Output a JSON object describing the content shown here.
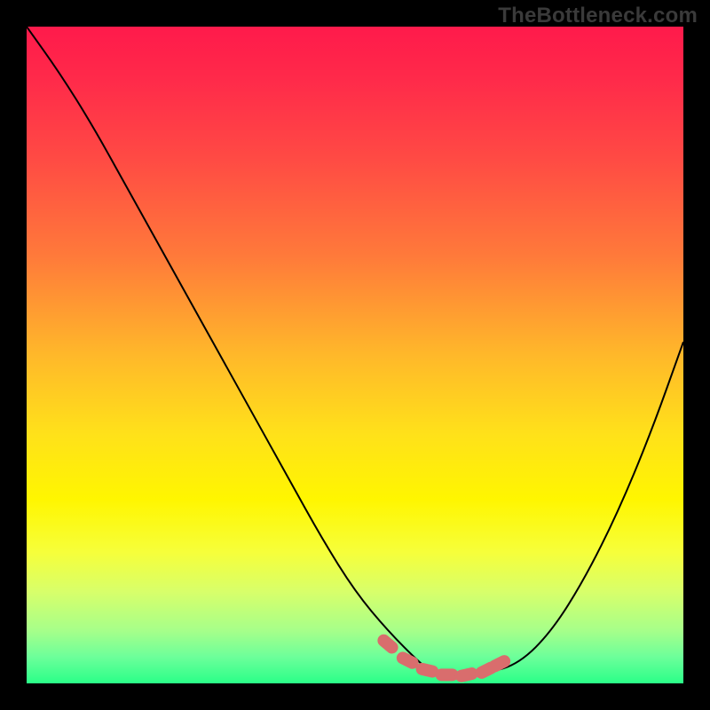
{
  "watermark": "TheBottleneck.com",
  "colors": {
    "page_bg": "#000000",
    "curve_stroke": "#000000",
    "marker_fill": "#d96d6d",
    "gradient_stops": [
      {
        "offset": 0.0,
        "color": "#ff1a4b"
      },
      {
        "offset": 0.08,
        "color": "#ff2a4a"
      },
      {
        "offset": 0.2,
        "color": "#ff4a44"
      },
      {
        "offset": 0.35,
        "color": "#ff7a3a"
      },
      {
        "offset": 0.5,
        "color": "#ffb82a"
      },
      {
        "offset": 0.62,
        "color": "#ffe11a"
      },
      {
        "offset": 0.72,
        "color": "#fff600"
      },
      {
        "offset": 0.8,
        "color": "#f6ff3a"
      },
      {
        "offset": 0.86,
        "color": "#d8ff6a"
      },
      {
        "offset": 0.92,
        "color": "#a6ff8a"
      },
      {
        "offset": 0.96,
        "color": "#6cff9a"
      },
      {
        "offset": 1.0,
        "color": "#2aff88"
      }
    ]
  },
  "chart_data": {
    "type": "line",
    "title": "",
    "xlabel": "",
    "ylabel": "",
    "xlim": [
      0,
      100
    ],
    "ylim": [
      0,
      100
    ],
    "annotations": [],
    "legend": [],
    "series": [
      {
        "name": "bottleneck-curve",
        "x": [
          0,
          5,
          10,
          15,
          20,
          25,
          30,
          35,
          40,
          45,
          50,
          55,
          60,
          62,
          64,
          66,
          70,
          75,
          80,
          85,
          90,
          95,
          100
        ],
        "y": [
          100,
          93,
          85,
          76,
          67,
          58,
          49,
          40,
          31,
          22,
          14,
          8,
          3,
          1.5,
          1,
          1,
          1.5,
          3,
          8,
          16,
          26,
          38,
          52
        ]
      }
    ],
    "markers": {
      "name": "near-minimum-markers",
      "x": [
        55,
        58,
        61,
        64,
        67,
        70,
        72
      ],
      "y": [
        6,
        3.5,
        2,
        1.3,
        1.3,
        2,
        3
      ]
    }
  }
}
